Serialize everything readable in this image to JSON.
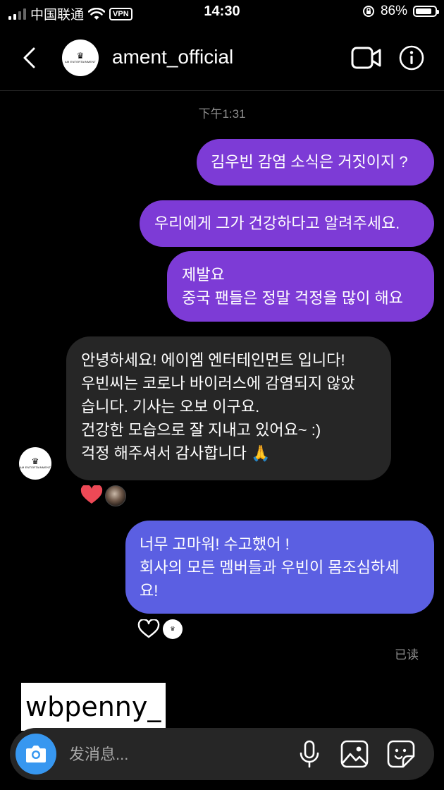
{
  "status_bar": {
    "carrier": "中国联通",
    "vpn": "VPN",
    "time": "14:30",
    "battery": "86%",
    "battery_level": 0.86
  },
  "header": {
    "username": "ament_official",
    "avatar_crown": "♛",
    "avatar_text": "AM ENTERTAINMENT"
  },
  "thread": {
    "timestamp": "下午1:31",
    "messages": [
      {
        "lines": [
          "김우빈 감염 소식은 거짓이지 ?"
        ]
      },
      {
        "lines": [
          "우리에게 그가 건강하다고 알려주세요."
        ]
      },
      {
        "lines": [
          "제발요",
          "중국 팬들은 정말 걱정을 많이 해요"
        ]
      },
      {
        "lines": [
          "안녕하세요! 에이엠 엔터테인먼트 입니다!",
          "우빈씨는 코로나 바이러스에 감염되지 않았",
          "습니다. 기사는 오보 이구요.",
          "건강한 모습으로 잘 지내고 있어요~ :)",
          "걱정 해주셔서 감사합니다 🙏"
        ]
      },
      {
        "lines": [
          "너무 고마워! 수고했어 !",
          "회사의 모든 멤버들과 우빈이 몸조심하세",
          "요!"
        ]
      }
    ],
    "seen": "已读"
  },
  "watermark": "wbpenny_",
  "composer": {
    "placeholder": "发消息..."
  },
  "colors": {
    "purple_bubble": "#7d3bd6",
    "blue_bubble": "#5b5fe2",
    "gray_bubble": "#262626",
    "heart": "#ed4956"
  }
}
